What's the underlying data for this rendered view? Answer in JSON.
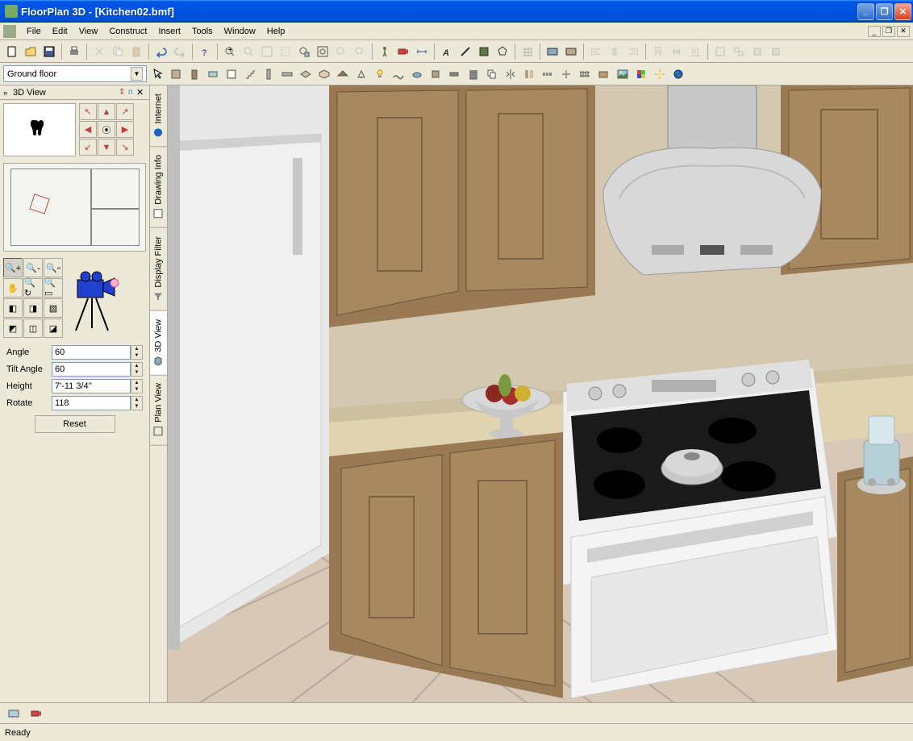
{
  "window": {
    "title": "FloorPlan 3D - [Kitchen02.bmf]"
  },
  "menu": [
    "File",
    "Edit",
    "View",
    "Construct",
    "Insert",
    "Tools",
    "Window",
    "Help"
  ],
  "floor_selector": "Ground floor",
  "panel": {
    "title": "3D View",
    "params": {
      "angle_label": "Angle",
      "angle_value": "60",
      "tilt_label": "Tilt Angle",
      "tilt_value": "60",
      "height_label": "Height",
      "height_value": "7'-11 3/4''",
      "rotate_label": "Rotate",
      "rotate_value": "118",
      "reset": "Reset"
    }
  },
  "side_tabs": [
    "Internet",
    "Drawing Info",
    "Display Filter",
    "3D View",
    "Plan View"
  ],
  "status": "Ready"
}
